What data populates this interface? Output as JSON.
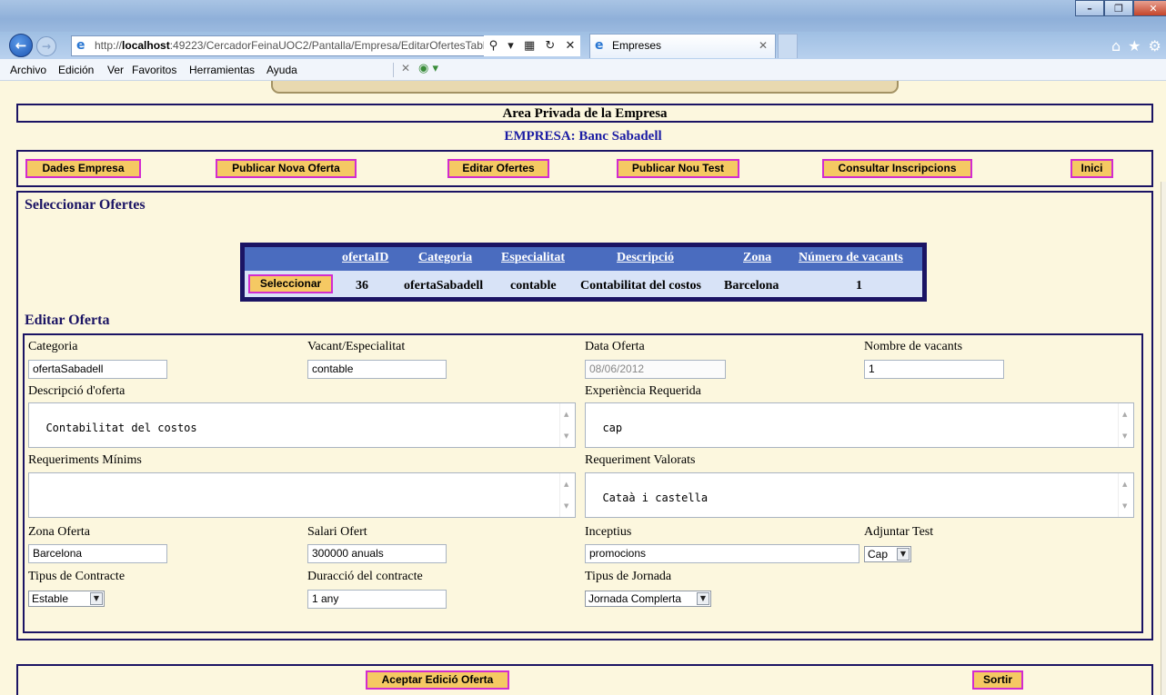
{
  "browser": {
    "url_prefix": "http://",
    "url_host": "localhost",
    "url_rest": ":49223/CercadorFeinaUOC2/Pantalla/Empresa/EditarOfertesTabla.asp›",
    "tab_title": "Empreses",
    "menu": [
      "Archivo",
      "Edición",
      "Ver",
      "Favoritos",
      "Herramientas",
      "Ayuda"
    ]
  },
  "header": {
    "area_title": "Area Privada de la Empresa",
    "company": "EMPRESA: Banc Sabadell"
  },
  "nav": {
    "dades": "Dades Empresa",
    "publicar_oferta": "Publicar Nova Oferta",
    "editar": "Editar Ofertes",
    "publicar_test": "Publicar Nou Test",
    "consultar": "Consultar Inscripcions",
    "inici": "Inici"
  },
  "select_section": {
    "title": "Seleccionar Ofertes",
    "columns": [
      "ofertaID",
      "Categoria",
      "Especialitat",
      "Descripció",
      "Zona",
      "Número de vacants"
    ],
    "row": {
      "button": "Seleccionar",
      "ofertaID": "36",
      "categoria": "ofertaSabadell",
      "especialitat": "contable",
      "descripcio": "Contabilitat del costos",
      "zona": "Barcelona",
      "vacants": "1"
    }
  },
  "edit_section": {
    "title": "Editar Oferta",
    "labels": {
      "categoria": "Categoria",
      "vacant": "Vacant/Especialitat",
      "data": "Data Oferta",
      "nombre": "Nombre de vacants",
      "descripcio": "Descripció d'oferta",
      "experiencia": "Experiència Requerida",
      "req_minims": "Requeriments Mínims",
      "req_valorats": "Requeriment Valorats",
      "zona": "Zona Oferta",
      "salari": "Salari Ofert",
      "inceptius": "Inceptius",
      "adjuntar": "Adjuntar Test",
      "tipus_contracte": "Tipus de Contracte",
      "duracio": "Duracció del contracte",
      "tipus_jornada": "Tipus de Jornada"
    },
    "values": {
      "categoria": "ofertaSabadell",
      "vacant": "contable",
      "data": "08/06/2012",
      "nombre": "1",
      "descripcio": "Contabilitat del costos",
      "experiencia": "cap",
      "req_minims": "",
      "req_valorats": "Cataà i castella",
      "zona": "Barcelona",
      "salari": "300000 anuals",
      "inceptius": "promocions",
      "adjuntar": "Cap",
      "tipus_contracte": "Estable",
      "duracio": "1 any",
      "tipus_jornada": "Jornada Complerta"
    }
  },
  "footer": {
    "accept": "Aceptar Edició Oferta",
    "exit": "Sortir"
  }
}
